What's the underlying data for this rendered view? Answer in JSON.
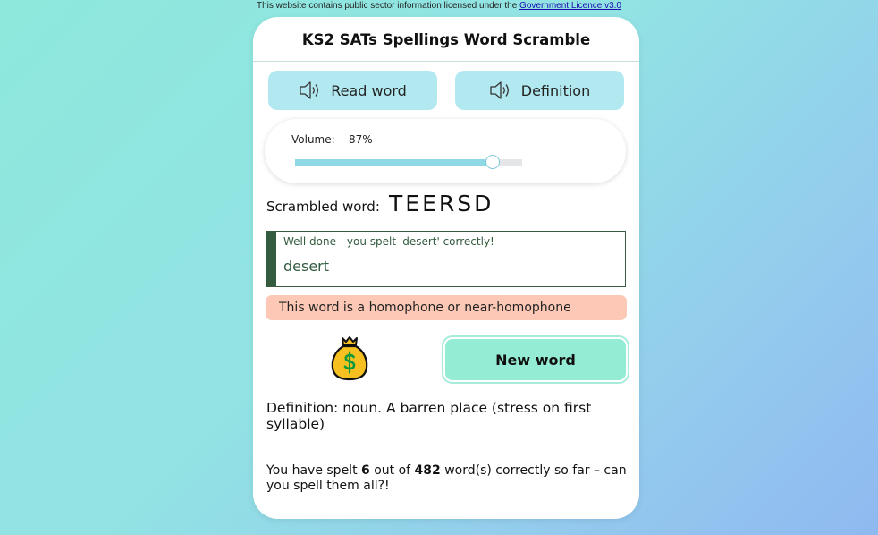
{
  "licence": {
    "text": "This website contains public sector information licensed under the ",
    "link": "Government Licence v3.0"
  },
  "app": {
    "title": "KS2 SATs Spellings Word Scramble"
  },
  "buttons": {
    "read_word": "Read word",
    "definition": "Definition",
    "new_word": "New word"
  },
  "icons": {
    "speaker": "speaker-icon",
    "reward": "money-bag-icon"
  },
  "volume": {
    "label": "Volume:",
    "value_text": "87%",
    "level": 0.87
  },
  "scramble": {
    "label": "Scrambled word:",
    "word": "TEERSD"
  },
  "answer": {
    "feedback": "Well done - you spelt 'desert' correctly!",
    "value": "desert"
  },
  "homophone_notice": "This word is a homophone or near-homophone",
  "definition_text": "Definition: noun. A barren place (stress on first syllable)",
  "progress": {
    "prefix": "You have spelt ",
    "correct": "6",
    "middle": " out of ",
    "total": "482",
    "suffix": " word(s) correctly so far – can you spell them all?!"
  },
  "colors": {
    "button_bg": "#b2e9f1",
    "new_word_bg": "#95ecd4",
    "success": "#335c3f",
    "notice_bg": "#fdc8b5",
    "slider_fill": "#8fd9e6"
  }
}
